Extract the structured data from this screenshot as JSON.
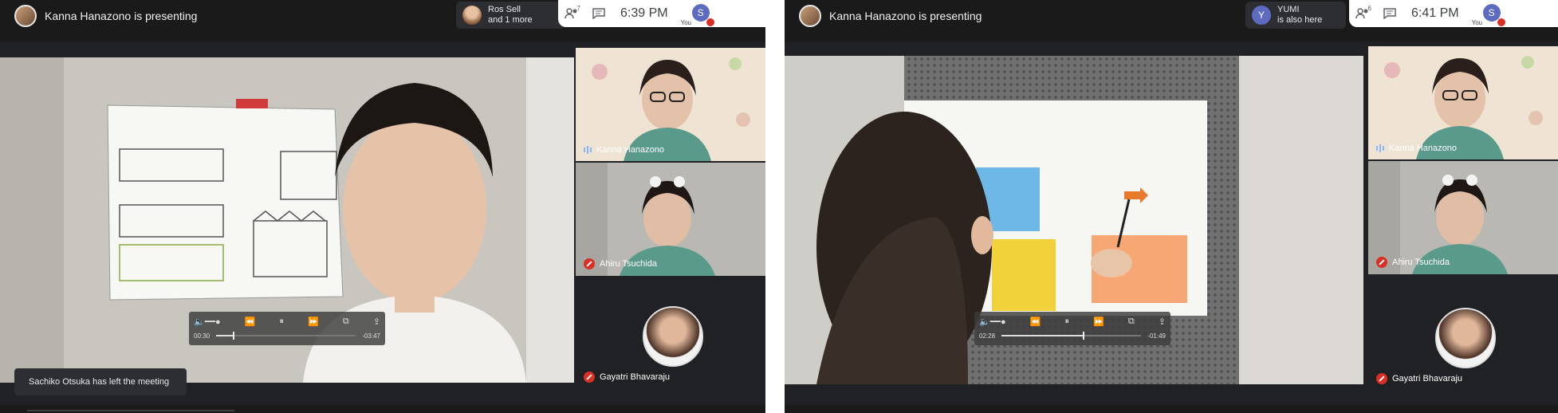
{
  "left": {
    "presenter_text": "Kanna Hanazono is presenting",
    "participants_pill": {
      "line1": "Ros Sell",
      "line2": "and 1 more"
    },
    "people_count": "7",
    "time": "6:39  PM",
    "you_label": "You",
    "you_initial": "S",
    "tiles": [
      {
        "name": "Kanna Hanazono",
        "muted": false
      },
      {
        "name": "Ahiru Tsuchida",
        "muted": true
      },
      {
        "name": "Gayatri Bhavaraju",
        "muted": true
      }
    ],
    "player": {
      "elapsed": "00:30",
      "remaining": "-03:47",
      "progress": 0.12
    },
    "toast": "Sachiko Otsuka has left the meeting"
  },
  "right": {
    "presenter_text": "Kanna Hanazono is presenting",
    "participants_pill": {
      "initial": "Y",
      "line1": "YUMI",
      "line2": "is also here"
    },
    "people_count": "6",
    "time": "6:41  PM",
    "you_label": "You",
    "you_initial": "S",
    "tiles": [
      {
        "name": "Kanna Hanazono",
        "muted": false
      },
      {
        "name": "Ahiru Tsuchida",
        "muted": true
      },
      {
        "name": "Gayatri Bhavaraju",
        "muted": true
      }
    ],
    "player": {
      "elapsed": "02:28",
      "remaining": "-01:49",
      "progress": 0.58
    }
  },
  "icons": {
    "people": "people-icon",
    "chat": "chat-icon",
    "mute": "mic-off-icon",
    "audio": "audio-level-icon",
    "rewind": "rewind-icon",
    "play_pause": "pause-icon",
    "forward": "fast-forward-icon"
  },
  "colors": {
    "mute_red": "#d93025",
    "avatar_blue": "#5c6bc0",
    "dark_bg": "#202124"
  }
}
